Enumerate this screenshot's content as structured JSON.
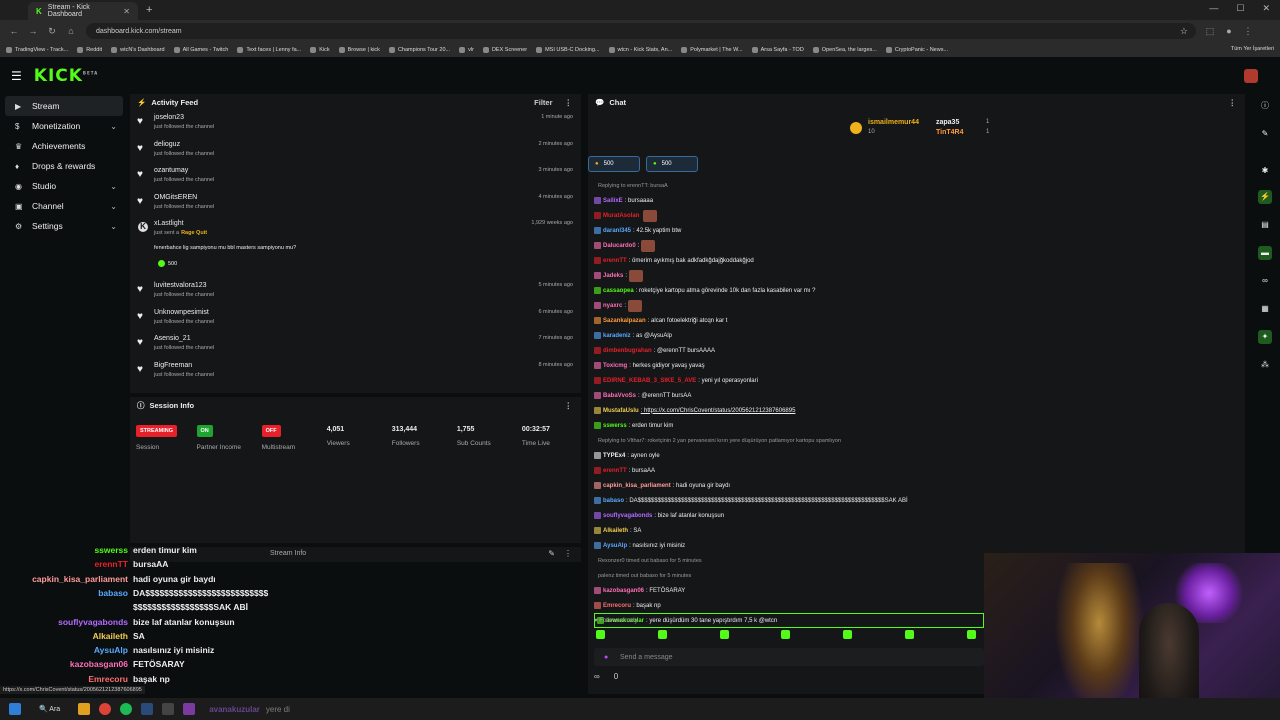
{
  "browser": {
    "tab_title": "Stream - Kick Dashboard",
    "url": "dashboard.kick.com/stream",
    "bookmarks": [
      "TradingView - Track...",
      "Reddit",
      "wtcN's Dashboard",
      "All Games - Twitch",
      "Text faces | Lenny fa...",
      "Kick",
      "Browse | kick",
      "Champions Tour 20...",
      "vlr",
      "DEX Screener",
      "MSI USB-C Docking...",
      "wtcn - Kick Stats, An...",
      "Polymarket | The W...",
      "Arsa Sayfa - TOD",
      "OpenSea, the larges...",
      "CryptoPanic - News..."
    ],
    "bookmarks_all": "Tüm Yer İşaretleri"
  },
  "header": {
    "logo": "KICK",
    "logo_sup": "BETA"
  },
  "sidebar": {
    "items": [
      {
        "label": "Stream",
        "icon": "play-icon"
      },
      {
        "label": "Monetization",
        "icon": "dollar-icon"
      },
      {
        "label": "Achievements",
        "icon": "trophy-icon"
      },
      {
        "label": "Drops & rewards",
        "icon": "gift-icon"
      },
      {
        "label": "Studio",
        "icon": "camera-icon"
      },
      {
        "label": "Channel",
        "icon": "channel-icon"
      },
      {
        "label": "Settings",
        "icon": "gear-icon"
      }
    ]
  },
  "activity": {
    "title": "Activity Feed",
    "filter": "Filter",
    "rows": [
      {
        "name": "joselon23",
        "sub": "just followed the channel",
        "time": "1 minute ago"
      },
      {
        "name": "delioguz",
        "sub": "just followed the channel",
        "time": "2 minutes ago"
      },
      {
        "name": "ozantumay",
        "sub": "just followed the channel",
        "time": "3 minutes ago"
      },
      {
        "name": "OMGitsEREN",
        "sub": "just followed the channel",
        "time": "4 minutes ago"
      }
    ],
    "host": {
      "name": "xLastlight",
      "sub": "just sent a",
      "item": "Rage Quit",
      "time": "1,929 weeks ago",
      "msg": "fenerbahce lig sampiyonu mu bbl masters sampiyonu mu?",
      "amount": "500"
    },
    "rows2": [
      {
        "name": "luvitestvalora123",
        "sub": "just followed the channel",
        "time": "5 minutes ago"
      },
      {
        "name": "Unknownpesimist",
        "sub": "just followed the channel",
        "time": "6 minutes ago"
      },
      {
        "name": "Asensio_21",
        "sub": "just followed the channel",
        "time": "7 minutes ago"
      },
      {
        "name": "BigFreeman",
        "sub": "just followed the channel",
        "time": "8 minutes ago"
      }
    ]
  },
  "session": {
    "title": "Session Info",
    "items": [
      {
        "pill": "STREAMING",
        "label": "Session",
        "color": "#e8202a"
      },
      {
        "pill": "ON",
        "label": "Partner Income",
        "color": "#1fa52f"
      },
      {
        "pill": "OFF",
        "label": "Multistream",
        "color": "#e8202a"
      },
      {
        "value": "4,051",
        "label": "Viewers"
      },
      {
        "value": "313,444",
        "label": "Followers"
      },
      {
        "value": "1,755",
        "label": "Sub Counts"
      },
      {
        "value": "00:32:57",
        "label": "Time Live"
      }
    ],
    "stream_info": "Stream Info"
  },
  "overlay": [
    {
      "u": "sswerss",
      "m": "erden timur kim",
      "c": "#53fc18"
    },
    {
      "u": "erennTT",
      "m": "bursaAA",
      "c": "#e8202a"
    },
    {
      "u": "capkin_kisa_parliament",
      "m": "hadi oyuna gir baydı",
      "c": "#ff9b9b"
    },
    {
      "u": "babaso",
      "m": "DA$$$$$$$$$$$$$$$$$$$$$$$$$$",
      "c": "#5aa9ff"
    },
    {
      "u": "",
      "m": "$$$$$$$$$$$$$$$$$SAK ABİ",
      "c": "#eee"
    },
    {
      "u": "souflyvagabonds",
      "m": "bize laf atanlar konuşsun",
      "c": "#b36bff"
    },
    {
      "u": "Alkaileth",
      "m": "SA",
      "c": "#f0d050"
    },
    {
      "u": "AysuAlp",
      "m": "nasılsınız iyi misiniz",
      "c": "#5aa9ff"
    },
    {
      "u": "kazobasgan06",
      "m": "FETÖSARAY",
      "c": "#ff6fb5"
    },
    {
      "u": "Emrecoru",
      "m": "başak np",
      "c": "#ff6f6f"
    }
  ],
  "chat": {
    "title": "Chat",
    "pinned": [
      {
        "name": "ismailmemur44",
        "count": "10"
      },
      {
        "name": "zapa35",
        "count": "1"
      },
      {
        "name": "TinT4R4",
        "count": "1"
      }
    ],
    "gifts": [
      "500",
      "500"
    ],
    "messages": [
      {
        "sys": "Replying to erennTT: bursaA"
      },
      {
        "u": "SailixE",
        "m": ": bursaaaa",
        "c": "#b36bff"
      },
      {
        "u": "MuratAsolan",
        "m": "",
        "c": "#e8202a",
        "emote": true
      },
      {
        "u": "daranl345",
        "m": ": 42.5k yaptim btw",
        "c": "#5aa9ff"
      },
      {
        "u": "Dalucardo0",
        "m": ":",
        "c": "#ff6fb5",
        "emote": true
      },
      {
        "u": "erennTT",
        "m": ": ömerim ayıkmış bak adkfadkğdajğkoddakğjod",
        "c": "#e8202a"
      },
      {
        "u": "Jadeks",
        "m": ":",
        "c": "#ff6fb5",
        "emote": true
      },
      {
        "u": "cassaopea",
        "m": ": roketçiye kartopu atma görevinde 10k dan fazla kasabilen var mı ?",
        "c": "#53fc18"
      },
      {
        "u": "nyaxrc",
        "m": ":",
        "c": "#ff6fb5",
        "emote": true
      },
      {
        "u": "Sazankalpazan",
        "m": ": alcan fotoelektriği atcqn kar t",
        "c": "#ff9b3b"
      },
      {
        "u": "karadeniz",
        "m": ": as @AysuAlp",
        "c": "#5aa9ff"
      },
      {
        "u": "dimbenbugrahan",
        "m": ": @erennTT bursAAAA",
        "c": "#e8202a"
      },
      {
        "u": "Toxicmg",
        "m": ": herkes gidiyor yavaş yavaş",
        "c": "#ff6fb5"
      },
      {
        "u": "EDIRNE_KEBAB_3_SIKE_5_AVE",
        "m": ": yeni yıl operasyonlari",
        "c": "#e8202a"
      },
      {
        "u": "BabaVvoSs",
        "m": ": @erennTT bursAA",
        "c": "#ff6fb5"
      },
      {
        "u": "MustafaUslu",
        "m": ": https://x.com/ChrisCovent/status/2005621212387606895",
        "c": "#f0d050",
        "link": true
      },
      {
        "u": "sswerss",
        "m": ": erden timur kim",
        "c": "#53fc18"
      },
      {
        "sys": "Replying to Vlthar7: roketçinin 2 yan pervanesini kırın yere düşürüyon patlamıyor kartopu spamlıyon"
      },
      {
        "u": "TYPEx4",
        "m": ": aynen oyle",
        "c": "#eee"
      },
      {
        "u": "erennTT",
        "m": ": bursaAA",
        "c": "#e8202a"
      },
      {
        "u": "capkin_kisa_parliament",
        "m": ": hadi oyuna gir baydı",
        "c": "#ff9b9b"
      },
      {
        "u": "babaso",
        "m": ": DA$$$$$$$$$$$$$$$$$$$$$$$$$$$$$$$$$$$$$$$$$$$$$$$$$$$$$$$$$$$$$$$$$$$$$$$$$$SAK ABİ",
        "c": "#5aa9ff"
      },
      {
        "u": "souflyvagabonds",
        "m": ": bize laf atanlar konuşsun",
        "c": "#b36bff"
      },
      {
        "u": "Alkaileth",
        "m": ": SA",
        "c": "#f0d050"
      },
      {
        "u": "AysuAlp",
        "m": ": nasılsınız iyi misiniz",
        "c": "#5aa9ff"
      },
      {
        "sys": "Rexonzer0 timed out babaso for 5 minutes"
      },
      {
        "sys": "palenz timed out babaso for 5 minutes"
      },
      {
        "u": "kazobasgan06",
        "m": ": FETÖSARAY",
        "c": "#ff6fb5"
      },
      {
        "u": "Emrecoru",
        "m": ": başak np",
        "c": "#ff6f6f"
      },
      {
        "u": "avanakuzular",
        "m": ": yere düşürdüm 30 tane yapıştırdım 7,5 k @wtcn",
        "c": "#53fc18"
      }
    ],
    "followers_only": "Followers only",
    "input_placeholder": "Send a message",
    "footer_count": "0"
  },
  "taskbar": {
    "search": "Ara",
    "ghost_user": "avanakuzular",
    "ghost_msg": "yere di"
  },
  "status_url": "https://x.com/ChrisCovent/status/2005621212387606895"
}
